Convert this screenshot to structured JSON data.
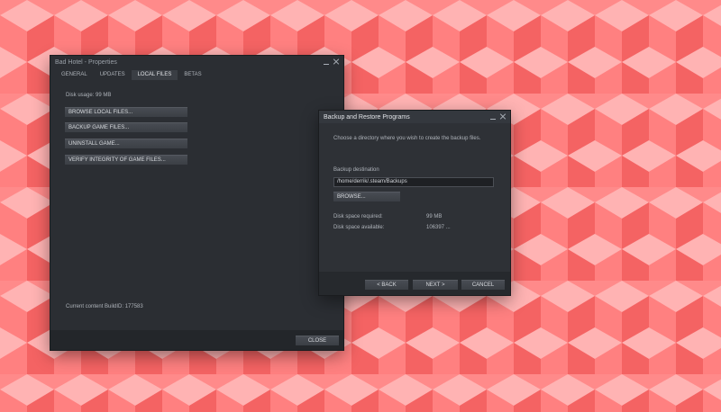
{
  "colors": {
    "wallpaper_light": "#ffaaaa",
    "wallpaper_mid": "#ff7f7f",
    "wallpaper_dark": "#f45d5d",
    "window_bg": "#2b2e33",
    "button_bg": "#43474d"
  },
  "properties_window": {
    "title": "Bad Hotel - Properties",
    "tabs": [
      {
        "label": "GENERAL"
      },
      {
        "label": "UPDATES"
      },
      {
        "label": "LOCAL FILES",
        "active": true
      },
      {
        "label": "BETAS"
      }
    ],
    "disk_usage": "Disk usage: 99 MB",
    "buttons": {
      "browse": "BROWSE LOCAL FILES...",
      "backup": "BACKUP GAME FILES...",
      "uninstall": "UNINSTALL GAME...",
      "verify": "VERIFY INTEGRITY OF GAME FILES..."
    },
    "build_id": "Current content BuildID: 177583",
    "close_label": "CLOSE"
  },
  "backup_dialog": {
    "title": "Backup and Restore Programs",
    "instruction": "Choose a directory where you wish to create the backup files.",
    "destination_label": "Backup destination",
    "destination_value": "/home/derrik/.steam/Backups",
    "browse_label": "BROWSE...",
    "space_required_label": "Disk space required:",
    "space_required_value": "99 MB",
    "space_available_label": "Disk space available:",
    "space_available_value": "106397 ...",
    "back_label": "< BACK",
    "next_label": "NEXT >",
    "cancel_label": "CANCEL"
  }
}
